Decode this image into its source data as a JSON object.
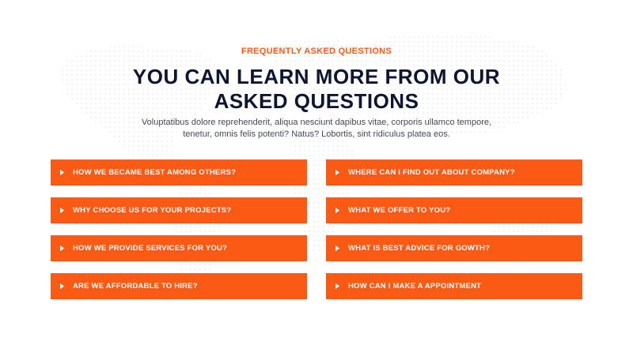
{
  "section": {
    "eyebrow": "FREQUENTLY ASKED QUESTIONS",
    "heading_line1": "YOU CAN LEARN MORE FROM OUR",
    "heading_line2": "ASKED QUESTIONS",
    "description_line1": "Voluptatibus dolore reprehenderit, aliqua nesciunt dapibus vitae, corporis ullamco tempore,",
    "description_line2": "tenetur, omnis felis potenti? Natus? Lobortis, sint ridiculus platea eos."
  },
  "faq": {
    "left": [
      {
        "question": "HOW WE BECAME BEST AMONG OTHERS?"
      },
      {
        "question": "WHY CHOOSE US FOR YOUR PROJECTS?"
      },
      {
        "question": "HOW WE PROVIDE SERVICES FOR YOU?"
      },
      {
        "question": "ARE WE AFFORDABLE TO HIRE?"
      }
    ],
    "right": [
      {
        "question": "WHERE CAN I FIND OUT ABOUT COMPANY?"
      },
      {
        "question": "WHAT WE OFFER TO YOU?"
      },
      {
        "question": "WHAT IS BEST ADVICE FOR GOWTH?"
      },
      {
        "question": "HOW CAN I MAKE A APPOINTMENT"
      }
    ]
  },
  "colors": {
    "accent": "#fb5a15",
    "heading": "#0e1530",
    "text": "#444a5a"
  },
  "icons": {
    "faq_item": "caret-right-icon"
  }
}
